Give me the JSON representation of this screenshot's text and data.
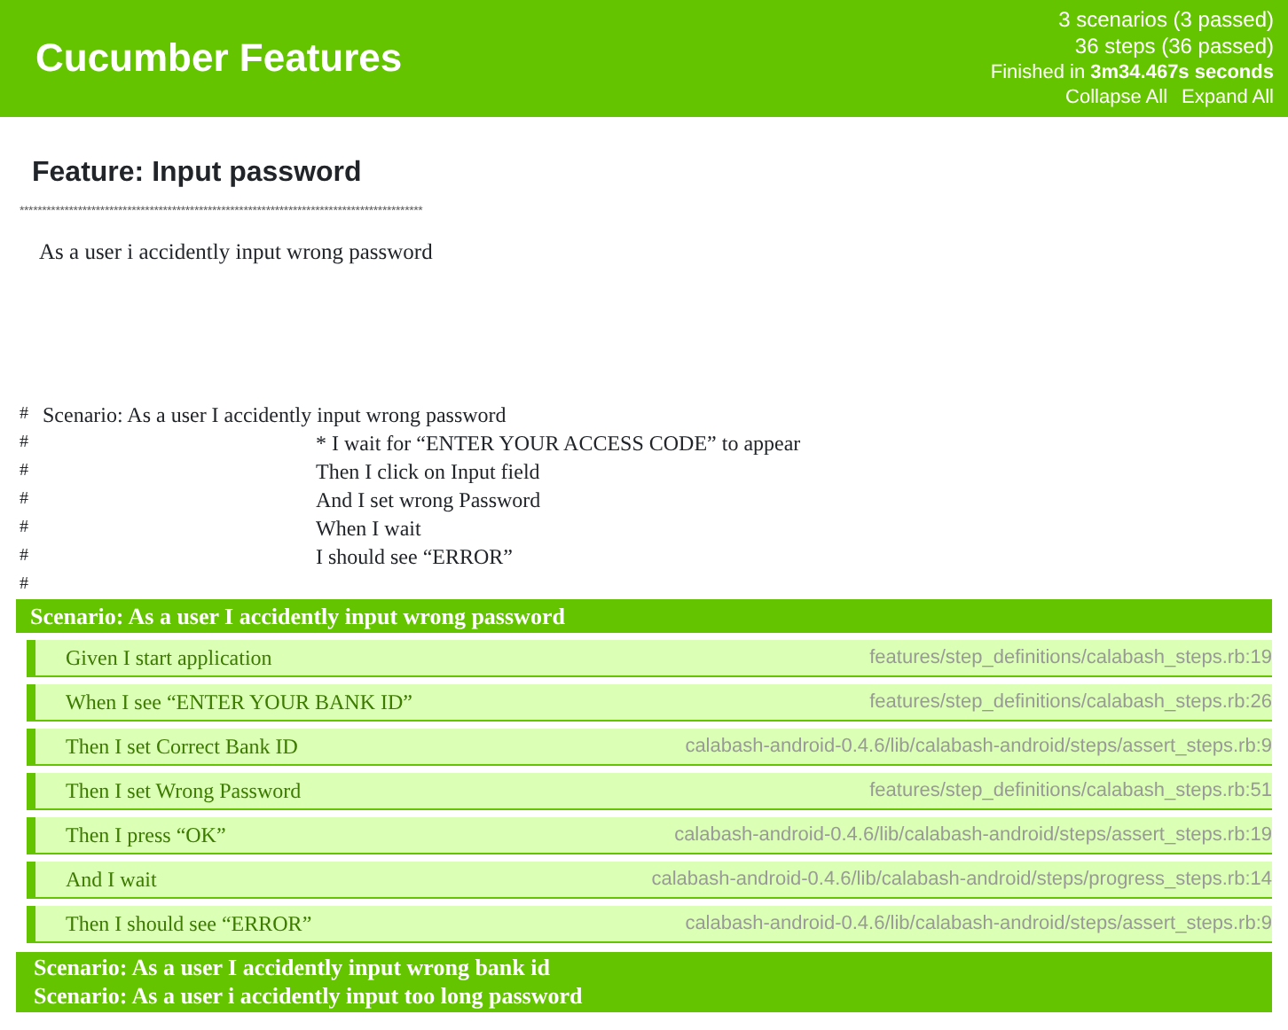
{
  "header": {
    "title": "Cucumber Features",
    "stats": [
      "3 scenarios (3 passed)",
      "36 steps (36 passed)"
    ],
    "finished": "Finished in **3m34.467s seconds**",
    "links": [
      "Collapse All",
      "Expand All"
    ]
  },
  "feature": {
    "title": "Feature: Input password",
    "rule": "******************************************************************************************",
    "description": "As a user i accidently input wrong password",
    "comment": [
      {
        "mark": "#",
        "kind": "scenario",
        "text": "Scenario: As a user I accidently input wrong password"
      },
      {
        "mark": "#",
        "kind": "step",
        "text": "* I wait for “ENTER YOUR ACCESS CODE” to appear"
      },
      {
        "mark": "#",
        "kind": "step",
        "text": "Then I click on Input field"
      },
      {
        "mark": "#",
        "kind": "step",
        "text": "And I set wrong Password"
      },
      {
        "mark": "#",
        "kind": "step",
        "text": "When I wait"
      },
      {
        "mark": "#",
        "kind": "step",
        "text": "I should see “ERROR”"
      },
      {
        "mark": "#",
        "kind": "blank"
      }
    ]
  },
  "scenarios": [
    {
      "title": "Scenario: As a user I accidently input wrong password",
      "expanded": true,
      "steps": [
        {
          "text": "Given I start application",
          "location": "features/step_definitions/calabash_steps.rb:19",
          "passed": true
        },
        {
          "text": "When I see “ENTER YOUR BANK ID”",
          "location": "features/step_definitions/calabash_steps.rb:26",
          "passed": true
        },
        {
          "text": "Then I set Correct Bank ID",
          "location": "calabash-android-0.4.6/lib/calabash-android/steps/assert_steps.rb:9",
          "passed": true
        },
        {
          "text": "Then I set Wrong Password",
          "location": "features/step_definitions/calabash_steps.rb:51",
          "passed": true
        },
        {
          "text": "Then I press “OK”",
          "location": "calabash-android-0.4.6/lib/calabash-android/steps/assert_steps.rb:19",
          "passed": true
        },
        {
          "text": "And I wait",
          "location": "calabash-android-0.4.6/lib/calabash-android/steps/progress_steps.rb:14",
          "passed": true
        },
        {
          "text": "Then I should see “ERROR”",
          "location": "calabash-android-0.4.6/lib/calabash-android/steps/assert_steps.rb:9",
          "passed": true
        }
      ]
    },
    {
      "title": "Scenario: As a user I accidently input wrong bank id",
      "expanded": false
    },
    {
      "title": "Scenario: As a user i accidently input too long password",
      "expanded": false
    }
  ]
}
